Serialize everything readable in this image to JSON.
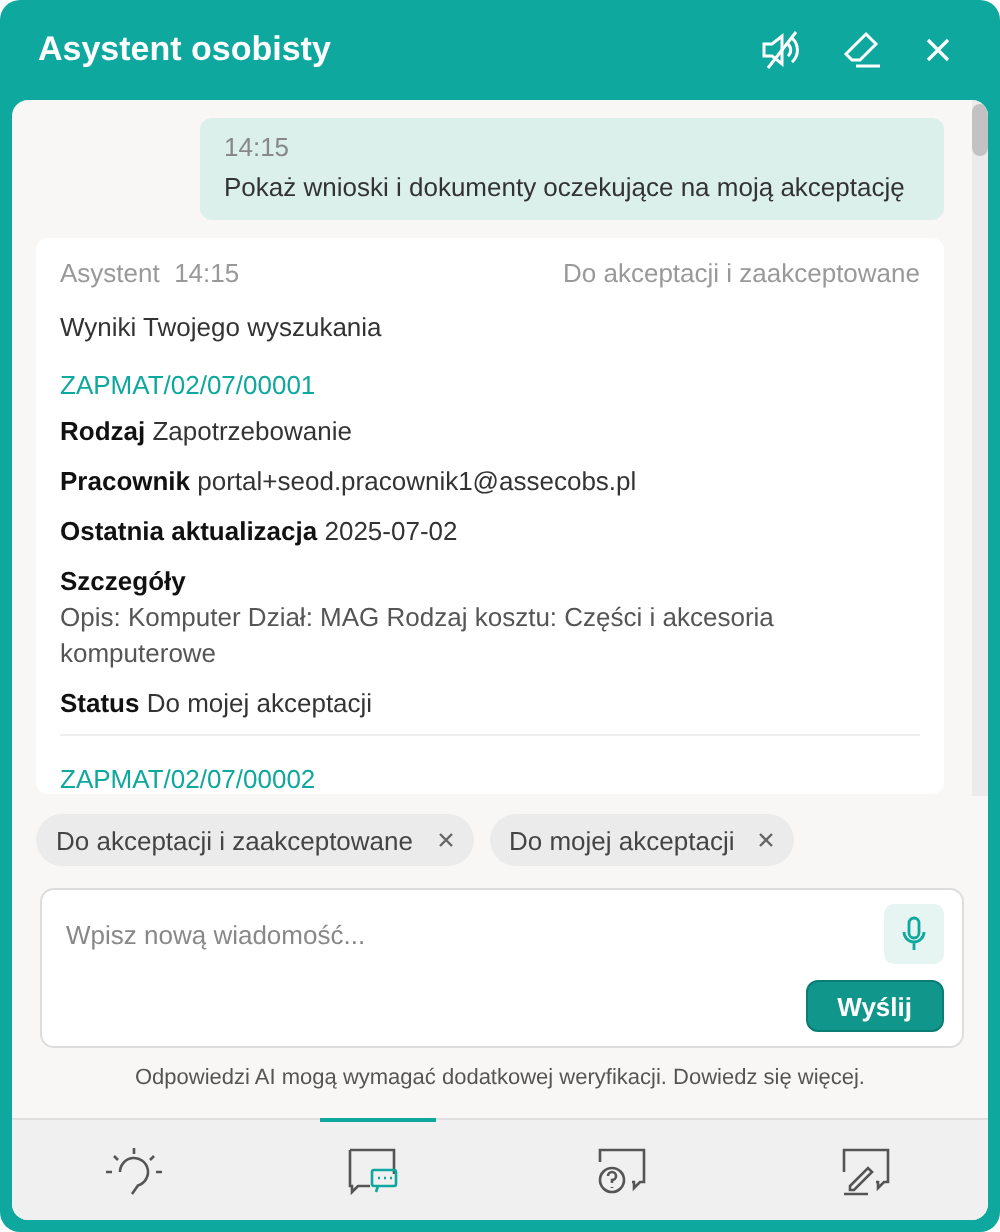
{
  "window": {
    "title": "Asystent osobisty"
  },
  "messages": [
    {
      "kind": "user",
      "time": "14:15",
      "text": "Pokaż wnioski i dokumenty oczekujące na moją akceptację"
    },
    {
      "kind": "assistant",
      "author": "Asystent",
      "time": "14:15",
      "filter": "Do akceptacji i zaakceptowane",
      "intro": "Wyniki Twojego wyszukania",
      "results": [
        {
          "id": "ZAPMAT/02/07/00001",
          "fields": [
            {
              "kind": "inline",
              "label": "Rodzaj",
              "value": "Zapotrzebowanie"
            },
            {
              "kind": "inline",
              "label": "Pracownik",
              "value": "portal+seod.pracownik1@assecobs.pl"
            },
            {
              "kind": "inline",
              "label": "Ostatnia aktualizacja",
              "value": "2025-07-02"
            },
            {
              "kind": "block",
              "label": "Szczegóły",
              "value": "Opis: Komputer Dział: MAG Rodzaj kosztu: Części i akcesoria komputerowe"
            },
            {
              "kind": "inline",
              "label": "Status",
              "value": "Do mojej akceptacji"
            }
          ]
        },
        {
          "id": "ZAPMAT/02/07/00002"
        }
      ]
    }
  ],
  "chips": [
    {
      "label": "Do akceptacji i zaakceptowane"
    },
    {
      "label": "Do mojej akceptacji"
    }
  ],
  "composer": {
    "placeholder": "Wpisz nową wiadomość...",
    "send": "Wyślij"
  },
  "disclaimer": "Odpowiedzi AI mogą wymagać dodatkowej weryfikacji. Dowiedz się więcej.",
  "tabs": [
    {
      "selected": false
    },
    {
      "selected": true
    },
    {
      "selected": false
    },
    {
      "selected": false
    }
  ]
}
